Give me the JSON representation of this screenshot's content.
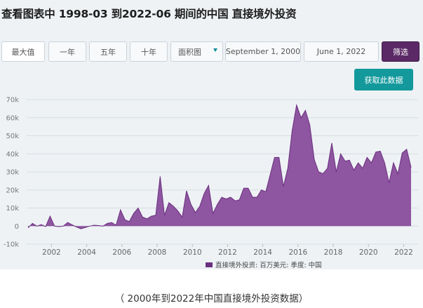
{
  "page": {
    "title": "查看图表中 1998-03 到2022-06 期间的中国 直接境外投资",
    "caption": "（ 2000年到2022年中国直接境外投资数据）"
  },
  "controls": {
    "buttons": [
      {
        "label": "最大值",
        "active": true
      },
      {
        "label": "一年",
        "active": false
      },
      {
        "label": "五年",
        "active": false
      },
      {
        "label": "十年",
        "active": false
      }
    ],
    "chart_type_select": {
      "value": "面积图"
    },
    "start_date": {
      "value": "September 1, 2000"
    },
    "end_date": {
      "value": "June 1, 2022"
    },
    "filter_label": "筛选",
    "fetch_label": "获取此数据"
  },
  "colors": {
    "fill": "#8e55a0",
    "stroke": "#6b2f7f",
    "teal": "#13999c",
    "purple_button": "#5b2a66",
    "grid": "#d7dde3"
  },
  "chart_data": {
    "type": "area",
    "ylim": [
      -10000,
      70000
    ],
    "yticks": [
      -10000,
      0,
      10000,
      20000,
      30000,
      40000,
      50000,
      60000,
      70000
    ],
    "ytick_labels": [
      "-10k",
      "0",
      "10k",
      "20k",
      "30k",
      "40k",
      "50k",
      "60k",
      "70k"
    ],
    "xlim": [
      2000.67,
      2022.5
    ],
    "xticks": [
      2002,
      2004,
      2006,
      2008,
      2010,
      2012,
      2014,
      2016,
      2018,
      2020,
      2022
    ],
    "xtick_labels": [
      "2002",
      "2004",
      "2006",
      "2008",
      "2010",
      "2012",
      "2014",
      "2016",
      "2018",
      "2020",
      "2022"
    ],
    "legend": {
      "label": "直接境外投资: 百万美元: 季度: 中国",
      "position": "bottom-right"
    },
    "grid": true,
    "series": [
      {
        "x": [
          2000.67,
          2000.92,
          2001.17,
          2001.42,
          2001.67,
          2001.92,
          2002.17,
          2002.42,
          2002.67,
          2002.92,
          2003.17,
          2003.42,
          2003.67,
          2003.92,
          2004.17,
          2004.42,
          2004.67,
          2004.92,
          2005.17,
          2005.42,
          2005.67,
          2005.92,
          2006.17,
          2006.42,
          2006.67,
          2006.92,
          2007.17,
          2007.42,
          2007.67,
          2007.92,
          2008.17,
          2008.42,
          2008.67,
          2008.92,
          2009.17,
          2009.42,
          2009.67,
          2009.92,
          2010.17,
          2010.42,
          2010.67,
          2010.92,
          2011.17,
          2011.42,
          2011.67,
          2011.92,
          2012.17,
          2012.42,
          2012.67,
          2012.92,
          2013.17,
          2013.42,
          2013.67,
          2013.92,
          2014.17,
          2014.42,
          2014.67,
          2014.92,
          2015.17,
          2015.42,
          2015.67,
          2015.92,
          2016.17,
          2016.42,
          2016.67,
          2016.92,
          2017.17,
          2017.42,
          2017.67,
          2017.92,
          2018.17,
          2018.42,
          2018.67,
          2018.92,
          2019.17,
          2019.42,
          2019.67,
          2019.92,
          2020.17,
          2020.42,
          2020.67,
          2020.92,
          2021.17,
          2021.42,
          2021.67,
          2021.92,
          2022.17,
          2022.42
        ],
        "values": [
          -1000,
          1500,
          0,
          800,
          -300,
          5500,
          0,
          -300,
          0,
          2000,
          700,
          -500,
          -1500,
          -800,
          0,
          500,
          300,
          0,
          1500,
          2000,
          500,
          9000,
          3500,
          2500,
          7000,
          10000,
          5000,
          4000,
          5500,
          6000,
          27500,
          6000,
          13000,
          11000,
          8500,
          5000,
          19500,
          12000,
          7500,
          11000,
          18000,
          22500,
          7000,
          12000,
          16000,
          15000,
          16000,
          14000,
          14500,
          21000,
          21000,
          16000,
          16000,
          20000,
          19000,
          28500,
          38000,
          38000,
          22000,
          32000,
          53000,
          67000,
          60000,
          64000,
          56000,
          37000,
          30000,
          29000,
          32000,
          46000,
          30000,
          40000,
          36000,
          36500,
          31000,
          35000,
          32000,
          38000,
          35000,
          41000,
          41500,
          35000,
          24000,
          35000,
          29000,
          40500,
          42500,
          32500
        ]
      }
    ]
  }
}
